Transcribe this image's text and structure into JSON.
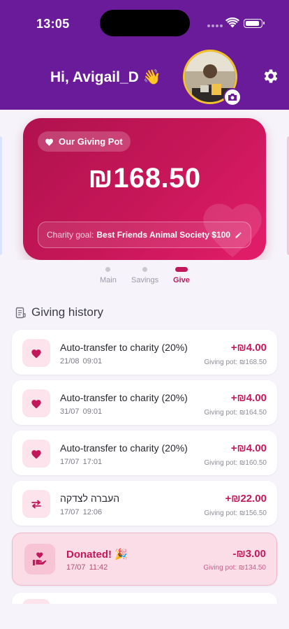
{
  "status_bar": {
    "time": "13:05"
  },
  "header": {
    "greeting": "Hi, Avigail_D 👋"
  },
  "card": {
    "badge_label": "Our Giving Pot",
    "amount": "₪168.50",
    "goal_label": "Charity goal:",
    "goal_value": "Best Friends Animal Society $100"
  },
  "pager": {
    "tabs": [
      {
        "label": "Main",
        "active": false
      },
      {
        "label": "Savings",
        "active": false
      },
      {
        "label": "Give",
        "active": true
      }
    ]
  },
  "history": {
    "title": "Giving history",
    "items": [
      {
        "icon": "heart-icon",
        "title": "Auto-transfer to charity (20%)",
        "date": "21/08  09:01",
        "amount": "+₪4.00",
        "balance": "Giving pot: ₪168.50"
      },
      {
        "icon": "heart-icon",
        "title": "Auto-transfer to charity (20%)",
        "date": "31/07  09:01",
        "amount": "+₪4.00",
        "balance": "Giving pot: ₪164.50"
      },
      {
        "icon": "heart-icon",
        "title": "Auto-transfer to charity (20%)",
        "date": "17/07  17:01",
        "amount": "+₪4.00",
        "balance": "Giving pot: ₪160.50"
      },
      {
        "icon": "transfer-arrows-icon",
        "title": "העברה לצדקה",
        "date": "17/07  12:06",
        "amount": "+₪22.00",
        "balance": "Giving pot: ₪156.50"
      },
      {
        "icon": "hand-heart-icon",
        "title": "Donated! 🎉",
        "date": "17/07  11:42",
        "amount": "-₪3.00",
        "balance": "Giving pot: ₪134.50"
      }
    ]
  },
  "colors": {
    "header": "#6a1b9a",
    "accent": "#c2185b",
    "card_start": "#b0124e",
    "card_end": "#e31d6a",
    "avatar_ring": "#f2c12e"
  }
}
